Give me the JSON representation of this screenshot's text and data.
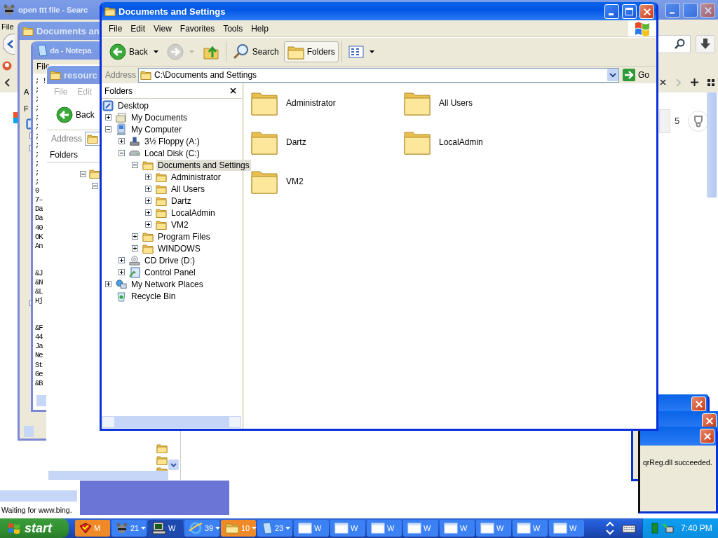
{
  "browser_window": {
    "title": "open ttt file - Searc",
    "menu": [
      "File"
    ],
    "sidebar_count": "5",
    "status": "Waiting for www.bing."
  },
  "explorer_window_back": {
    "title": "Documents an",
    "labels": [
      "A",
      "F"
    ]
  },
  "notepad_window": {
    "title": "da - Notepa",
    "menu": [
      "File"
    ],
    "blocks": [
      {
        "lines": [
          "; !",
          ";",
          ";",
          ";",
          ";",
          ";",
          ";",
          ";",
          ";",
          ";",
          ";",
          ";",
          "0",
          "7–",
          "Da",
          "Da",
          "40",
          "OK",
          "An"
        ]
      },
      {
        "lines": [
          "&J",
          "&N",
          "&L",
          "Hj"
        ]
      },
      {
        "lines": [
          "&F",
          "44",
          "Ja",
          "Ne",
          "St",
          "Ge",
          "&B"
        ]
      }
    ]
  },
  "resources_window": {
    "title": "resourc",
    "menu": [
      "File",
      "Edit"
    ],
    "back_label": "Back",
    "address_label": "Address",
    "folders_label": "Folders"
  },
  "explorer_window": {
    "title": "Documents and Settings",
    "menu": [
      "File",
      "Edit",
      "View",
      "Favorites",
      "Tools",
      "Help"
    ],
    "toolbar": [
      {
        "kind": "back",
        "label": "Back",
        "disabled": false
      },
      {
        "kind": "forward",
        "disabled": true
      },
      {
        "kind": "up",
        "disabled": false
      },
      {
        "kind": "search",
        "label": "Search",
        "selected": false
      },
      {
        "kind": "folders",
        "label": "Folders",
        "selected": true
      },
      {
        "kind": "views"
      }
    ],
    "address_label": "Address",
    "address": "C:\\Documents and Settings",
    "go_label": "Go",
    "folders_pane": {
      "title": "Folders",
      "tree": {
        "label": "Desktop",
        "kind": "desktop",
        "selected": false,
        "children": [
          {
            "label": "My Documents",
            "kind": "documents",
            "expanded": false,
            "selected": false
          },
          {
            "label": "My Computer",
            "kind": "computer",
            "expanded": true,
            "selected": false,
            "children": [
              {
                "label": "3½ Floppy (A:)",
                "kind": "floppy",
                "expanded": false,
                "selected": false
              },
              {
                "label": "Local Disk (C:)",
                "kind": "disk",
                "expanded": true,
                "selected": false,
                "children": [
                  {
                    "label": "Documents and Settings",
                    "kind": "folder",
                    "expanded": true,
                    "selected": true,
                    "children": [
                      {
                        "label": "Administrator",
                        "kind": "folder",
                        "expanded": false,
                        "selected": false
                      },
                      {
                        "label": "All Users",
                        "kind": "folder",
                        "expanded": false,
                        "selected": false
                      },
                      {
                        "label": "Dartz",
                        "kind": "folder",
                        "expanded": false,
                        "selected": false
                      },
                      {
                        "label": "LocalAdmin",
                        "kind": "folder",
                        "expanded": false,
                        "selected": false
                      },
                      {
                        "label": "VM2",
                        "kind": "folder",
                        "expanded": false,
                        "selected": false
                      }
                    ]
                  },
                  {
                    "label": "Program Files",
                    "kind": "folder",
                    "expanded": false,
                    "selected": false
                  },
                  {
                    "label": "WINDOWS",
                    "kind": "folder",
                    "expanded": false,
                    "selected": false
                  }
                ]
              },
              {
                "label": "CD Drive (D:)",
                "kind": "cd",
                "expanded": false,
                "selected": false
              },
              {
                "label": "Control Panel",
                "kind": "control",
                "expanded": false,
                "selected": false
              }
            ]
          },
          {
            "label": "My Network Places",
            "kind": "network",
            "expanded": false,
            "selected": false
          },
          {
            "label": "Recycle Bin",
            "kind": "recycle",
            "selected": false
          }
        ]
      }
    },
    "items": [
      {
        "name": "Administrator",
        "selected": false
      },
      {
        "name": "All Users",
        "selected": false
      },
      {
        "name": "Dartz",
        "selected": false
      },
      {
        "name": "LocalAdmin",
        "selected": false
      },
      {
        "name": "VM2",
        "selected": false
      }
    ]
  },
  "dialogs": [
    {
      "kind": "covered"
    },
    {
      "kind": "covered"
    },
    {
      "kind": "message",
      "message": "qrReg.dll succeeded."
    }
  ],
  "taskbar": {
    "start_label": "start",
    "buttons": [
      {
        "label": "M",
        "kind": "shield",
        "flashing": true,
        "selected": false,
        "grouped": false
      },
      {
        "label": "21",
        "kind": "raccoon",
        "flashing": false,
        "selected": false,
        "grouped": true
      },
      {
        "label": "W",
        "kind": "computer",
        "flashing": false,
        "selected": true,
        "grouped": false
      },
      {
        "label": "39",
        "kind": "browser",
        "flashing": false,
        "selected": false,
        "grouped": true
      },
      {
        "label": "10",
        "kind": "folder",
        "flashing": true,
        "selected": false,
        "grouped": true
      },
      {
        "label": "23",
        "kind": "notepad",
        "flashing": false,
        "selected": false,
        "grouped": true
      },
      {
        "label": "W",
        "kind": "window",
        "flashing": false,
        "selected": false,
        "grouped": false
      },
      {
        "label": "W",
        "kind": "window",
        "flashing": false,
        "selected": false,
        "grouped": false
      },
      {
        "label": "W",
        "kind": "window",
        "flashing": false,
        "selected": false,
        "grouped": false
      },
      {
        "label": "W",
        "kind": "window",
        "flashing": false,
        "selected": false,
        "grouped": false
      },
      {
        "label": "W",
        "kind": "window",
        "flashing": false,
        "selected": false,
        "grouped": false
      },
      {
        "label": "W",
        "kind": "window",
        "flashing": false,
        "selected": false,
        "grouped": false
      },
      {
        "label": "W",
        "kind": "window",
        "flashing": false,
        "selected": false,
        "grouped": false
      },
      {
        "label": "W",
        "kind": "window",
        "flashing": false,
        "selected": false,
        "grouped": false
      }
    ],
    "clock": "7:40 PM"
  }
}
